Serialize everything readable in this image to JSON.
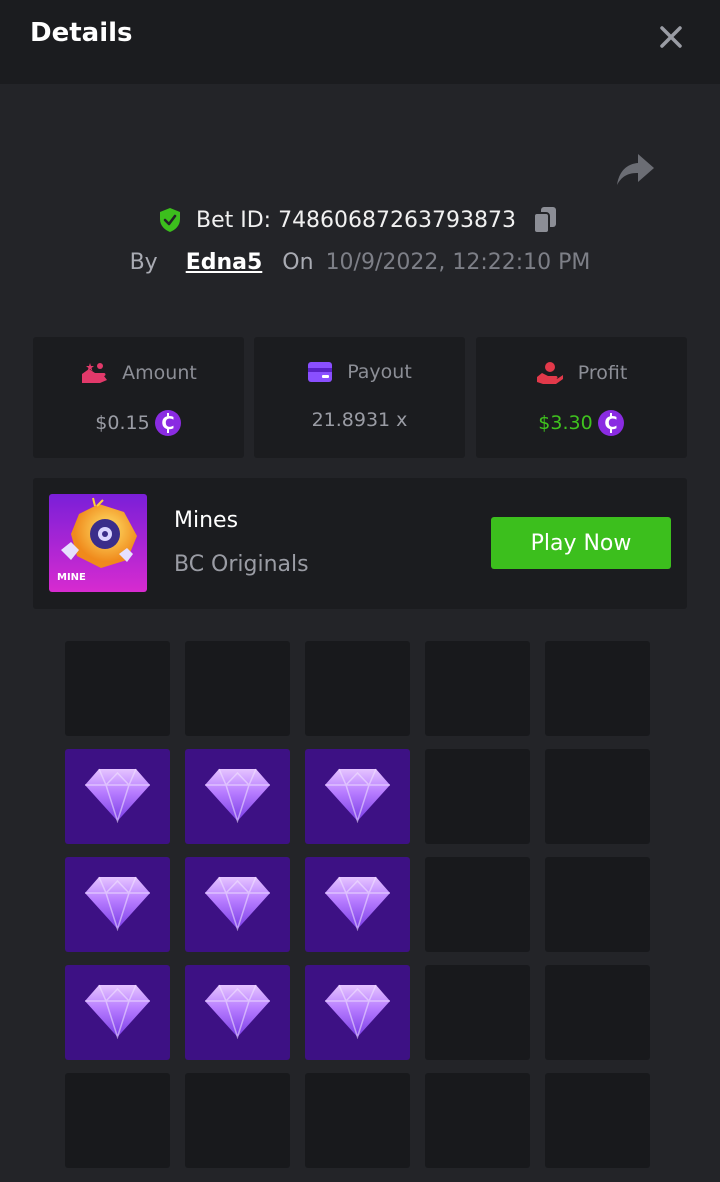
{
  "header": {
    "title": "Details"
  },
  "bet": {
    "id_label": "Bet ID: 74860687263793873",
    "by_label": "By",
    "username": "Edna5",
    "on_label": "On",
    "datetime": "10/9/2022, 12:22:10 PM"
  },
  "stats": [
    {
      "label": "Amount",
      "value": "$0.15",
      "currency_icon": "coin-icon"
    },
    {
      "label": "Payout",
      "value": "21.8931 x"
    },
    {
      "label": "Profit",
      "value": "$3.30",
      "currency_icon": "coin-icon",
      "value_color": "#3fc21e"
    }
  ],
  "game": {
    "name": "Mines",
    "provider": "BC Originals",
    "thumb_label": "MINE",
    "play_label": "Play Now"
  },
  "board": {
    "rows": 5,
    "cols": 5,
    "revealed": [
      [
        0,
        0,
        0,
        0,
        0
      ],
      [
        1,
        1,
        1,
        0,
        0
      ],
      [
        1,
        1,
        1,
        0,
        0
      ],
      [
        1,
        1,
        1,
        0,
        0
      ],
      [
        0,
        0,
        0,
        0,
        0
      ]
    ],
    "revealed_icon": "diamond-icon"
  },
  "colors": {
    "accent_green": "#3cbf1d",
    "gem_tile": "#3d1184",
    "coin": "#8a2be2"
  }
}
